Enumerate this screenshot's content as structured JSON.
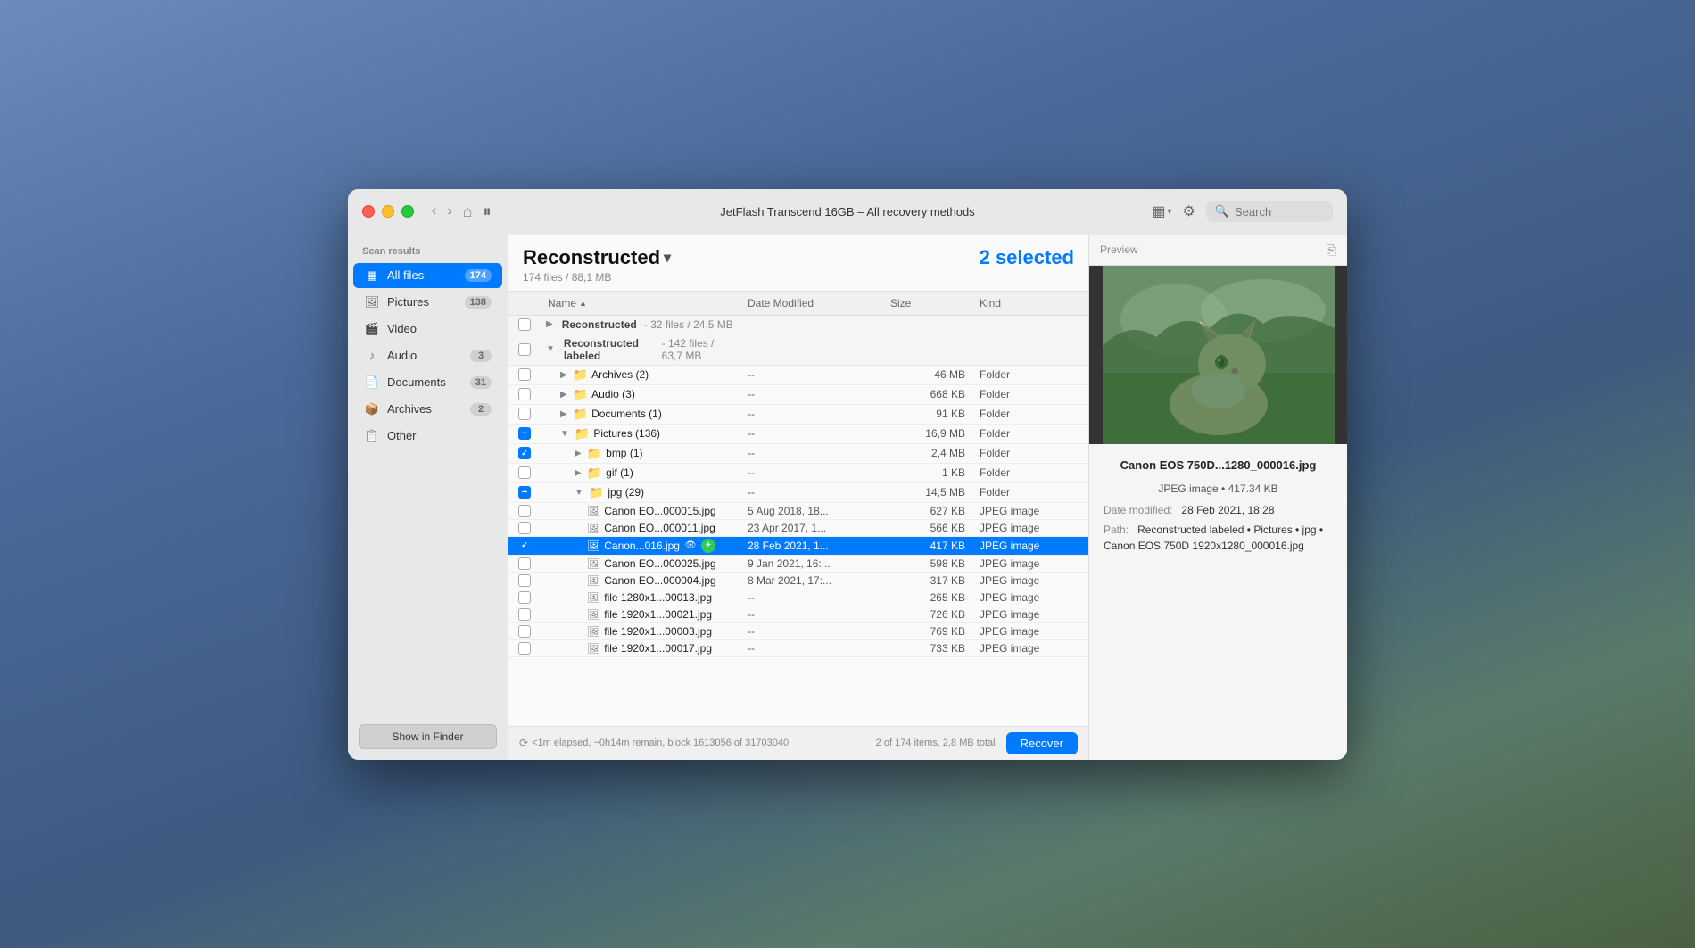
{
  "window": {
    "title": "JetFlash Transcend 16GB – All recovery methods"
  },
  "toolbar": {
    "search_placeholder": "Search",
    "pause_label": "⏸",
    "back_label": "‹",
    "forward_label": "›",
    "home_label": "⌂"
  },
  "sidebar": {
    "scan_results_label": "Scan results",
    "items": [
      {
        "id": "all-files",
        "label": "All files",
        "count": "174",
        "active": true,
        "icon": "grid"
      },
      {
        "id": "pictures",
        "label": "Pictures",
        "count": "138",
        "active": false,
        "icon": "photo"
      },
      {
        "id": "video",
        "label": "Video",
        "count": "",
        "active": false,
        "icon": "video"
      },
      {
        "id": "audio",
        "label": "Audio",
        "count": "3",
        "active": false,
        "icon": "music"
      },
      {
        "id": "documents",
        "label": "Documents",
        "count": "31",
        "active": false,
        "icon": "doc"
      },
      {
        "id": "archives",
        "label": "Archives",
        "count": "2",
        "active": false,
        "icon": "archive"
      },
      {
        "id": "other",
        "label": "Other",
        "count": "",
        "active": false,
        "icon": "other"
      }
    ],
    "show_finder_label": "Show in Finder"
  },
  "file_panel": {
    "folder_title": "Reconstructed",
    "file_count": "174 files / 88,1 MB",
    "selected_count": "2 selected",
    "columns": {
      "name": "Name",
      "date_modified": "Date Modified",
      "size": "Size",
      "kind": "Kind"
    },
    "groups": [
      {
        "id": "reconstructed",
        "label": "Reconstructed",
        "sublabel": "32 files / 24,5 MB",
        "expanded": false,
        "indent": 0
      },
      {
        "id": "reconstructed-labeled",
        "label": "Reconstructed labeled",
        "sublabel": "142 files / 63,7 MB",
        "expanded": true,
        "indent": 0
      }
    ],
    "rows": [
      {
        "id": "archives-folder",
        "indent": 1,
        "name": "Archives (2)",
        "date": "--",
        "size": "46 MB",
        "kind": "Folder",
        "type": "folder",
        "checked": false,
        "indeterminate": false,
        "expanded": false
      },
      {
        "id": "audio-folder",
        "indent": 1,
        "name": "Audio (3)",
        "date": "--",
        "size": "668 KB",
        "kind": "Folder",
        "type": "folder",
        "checked": false,
        "indeterminate": false,
        "expanded": false
      },
      {
        "id": "documents-folder",
        "indent": 1,
        "name": "Documents (1)",
        "date": "--",
        "size": "91 KB",
        "kind": "Folder",
        "type": "folder",
        "checked": false,
        "indeterminate": false,
        "expanded": false
      },
      {
        "id": "pictures-folder",
        "indent": 1,
        "name": "Pictures (136)",
        "date": "--",
        "size": "16,9 MB",
        "kind": "Folder",
        "type": "folder",
        "checked": false,
        "indeterminate": true,
        "expanded": true
      },
      {
        "id": "bmp-folder",
        "indent": 2,
        "name": "bmp (1)",
        "date": "--",
        "size": "2,4 MB",
        "kind": "Folder",
        "type": "folder",
        "checked": true,
        "indeterminate": false,
        "expanded": false
      },
      {
        "id": "gif-folder",
        "indent": 2,
        "name": "gif (1)",
        "date": "--",
        "size": "1 KB",
        "kind": "Folder",
        "type": "folder",
        "checked": false,
        "indeterminate": false,
        "expanded": false
      },
      {
        "id": "jpg-folder",
        "indent": 2,
        "name": "jpg (29)",
        "date": "--",
        "size": "14,5 MB",
        "kind": "Folder",
        "type": "folder",
        "checked": false,
        "indeterminate": true,
        "expanded": true
      },
      {
        "id": "canon-000015",
        "indent": 3,
        "name": "Canon EO...000015.jpg",
        "date": "5 Aug 2018, 18...",
        "size": "627 KB",
        "kind": "JPEG image",
        "type": "file",
        "checked": false,
        "indeterminate": false,
        "selected": false
      },
      {
        "id": "canon-000011",
        "indent": 3,
        "name": "Canon EO...000011.jpg",
        "date": "23 Apr 2017, 1...",
        "size": "566 KB",
        "kind": "JPEG image",
        "type": "file",
        "checked": false,
        "indeterminate": false,
        "selected": false
      },
      {
        "id": "canon-000016",
        "indent": 3,
        "name": "Canon...016.jpg",
        "date": "28 Feb 2021, 1...",
        "size": "417 KB",
        "kind": "JPEG image",
        "type": "file",
        "checked": true,
        "indeterminate": false,
        "selected": true
      },
      {
        "id": "canon-000025",
        "indent": 3,
        "name": "Canon EO...000025.jpg",
        "date": "9 Jan 2021, 16:...",
        "size": "598 KB",
        "kind": "JPEG image",
        "type": "file",
        "checked": false,
        "indeterminate": false,
        "selected": false
      },
      {
        "id": "canon-000004",
        "indent": 3,
        "name": "Canon EO...000004.jpg",
        "date": "8 Mar 2021, 17:...",
        "size": "317 KB",
        "kind": "JPEG image",
        "type": "file",
        "checked": false,
        "indeterminate": false,
        "selected": false
      },
      {
        "id": "file-13",
        "indent": 3,
        "name": "file 1280x1...00013.jpg",
        "date": "--",
        "size": "265 KB",
        "kind": "JPEG image",
        "type": "file",
        "checked": false,
        "indeterminate": false,
        "selected": false
      },
      {
        "id": "file-21",
        "indent": 3,
        "name": "file 1920x1...00021.jpg",
        "date": "--",
        "size": "726 KB",
        "kind": "JPEG image",
        "type": "file",
        "checked": false,
        "indeterminate": false,
        "selected": false
      },
      {
        "id": "file-03",
        "indent": 3,
        "name": "file 1920x1...00003.jpg",
        "date": "--",
        "size": "769 KB",
        "kind": "JPEG image",
        "type": "file",
        "checked": false,
        "indeterminate": false,
        "selected": false
      },
      {
        "id": "file-17",
        "indent": 3,
        "name": "file 1920x1...00017.jpg",
        "date": "--",
        "size": "733 KB",
        "kind": "JPEG image",
        "type": "file",
        "checked": false,
        "indeterminate": false,
        "selected": false
      }
    ]
  },
  "preview": {
    "header_label": "Preview",
    "filename": "Canon EOS 750D...1280_000016.jpg",
    "meta": "JPEG image • 417.34 KB",
    "date_label": "Date modified:",
    "date_value": "28 Feb 2021, 18:28",
    "path_label": "Path:",
    "path_value": "Reconstructed labeled • Pictures • jpg • Canon EOS 750D 1920x1280_000016.jpg"
  },
  "status_bar": {
    "progress_text": "<1m elapsed, ~0h14m remain, block 1613056 of 31703040",
    "items_text": "2 of 174 items, 2,8 MB total",
    "recover_label": "Recover"
  }
}
